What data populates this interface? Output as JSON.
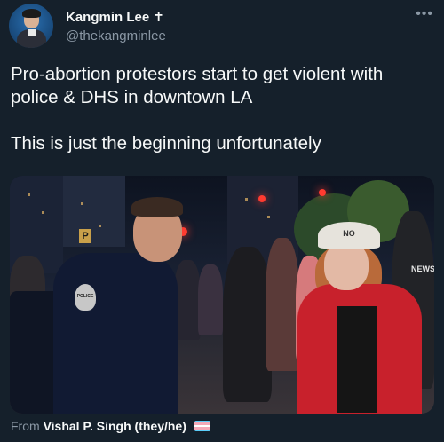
{
  "author": {
    "name": "Kangmin Lee",
    "badge_glyph": "✝",
    "handle": "@thekangminlee"
  },
  "more_icon": "more-horizontal-icon",
  "tweet": {
    "line1": "Pro-abortion protestors start to get violent with police & DHS in downtown LA",
    "line2": "This is just the beginning unfortunately"
  },
  "media": {
    "street_sign": "P",
    "badge_text": "POLICE",
    "cap_text": "NO",
    "jacket_text": "NEWS"
  },
  "credit": {
    "prefix": "From",
    "source": "Vishal P. Singh (they/he)",
    "flag_colors": [
      "#5bcefa",
      "#f5a9b8",
      "#ffffff",
      "#f5a9b8",
      "#5bcefa"
    ]
  }
}
